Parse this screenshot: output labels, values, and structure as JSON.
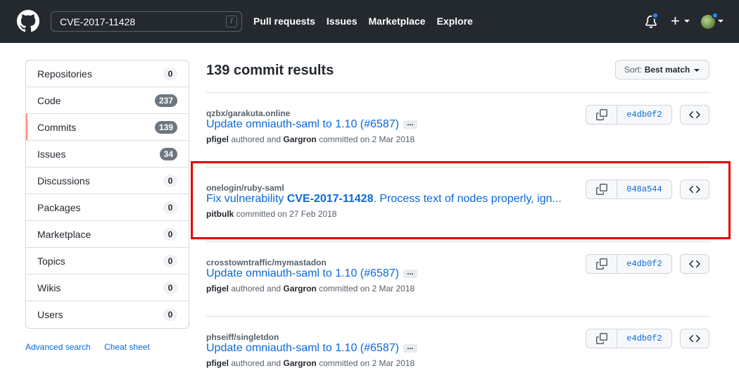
{
  "header": {
    "search_value": "CVE-2017-11428",
    "search_shortcut": "/",
    "nav": [
      "Pull requests",
      "Issues",
      "Marketplace",
      "Explore"
    ],
    "plus_label": "+"
  },
  "sidebar": {
    "items": [
      {
        "label": "Repositories",
        "count": "0"
      },
      {
        "label": "Code",
        "count": "237"
      },
      {
        "label": "Commits",
        "count": "139"
      },
      {
        "label": "Issues",
        "count": "34"
      },
      {
        "label": "Discussions",
        "count": "0"
      },
      {
        "label": "Packages",
        "count": "0"
      },
      {
        "label": "Marketplace",
        "count": "0"
      },
      {
        "label": "Topics",
        "count": "0"
      },
      {
        "label": "Wikis",
        "count": "0"
      },
      {
        "label": "Users",
        "count": "0"
      }
    ],
    "selected": "Commits",
    "advanced_search": "Advanced search",
    "cheat_sheet": "Cheat sheet"
  },
  "main": {
    "title": "139 commit results",
    "sort_prefix": "Sort:",
    "sort_value": "Best match",
    "commits": [
      {
        "repo": "qzbx/garakuta.online",
        "message": "Update omniauth-saml to 1.10 (#6587)",
        "has_ellipsis": true,
        "author": "pfigel",
        "author_action": "authored and",
        "committer": "Gargron",
        "date_text": "committed on 2 Mar 2018",
        "sha": "e4db0f2"
      },
      {
        "repo": "onelogin/ruby-saml",
        "message_pre": "Fix vulnerability ",
        "message_bold": "CVE-2017-11428",
        "message_post": ". Process text of nodes properly, ign...",
        "author": "pitbulk",
        "date_text": "committed on 27 Feb 2018",
        "sha": "048a544"
      },
      {
        "repo": "crosstowntraffic/mymastadon",
        "message": "Update omniauth-saml to 1.10 (#6587)",
        "has_ellipsis": true,
        "author": "pfigel",
        "author_action": "authored and",
        "committer": "Gargron",
        "date_text": "committed on 2 Mar 2018",
        "sha": "e4db0f2"
      },
      {
        "repo": "phseiff/singletdon",
        "message": "Update omniauth-saml to 1.10 (#6587)",
        "has_ellipsis": true,
        "author": "pfigel",
        "author_action": "authored and",
        "committer": "Gargron",
        "date_text": "committed on 2 Mar 2018",
        "sha": "e4db0f2"
      }
    ],
    "ellipsis_label": "..."
  },
  "colors": {
    "header_bg": "#24292f",
    "link": "#0969da",
    "highlight": "#e00000",
    "selected_marker": "#fd8c73"
  }
}
